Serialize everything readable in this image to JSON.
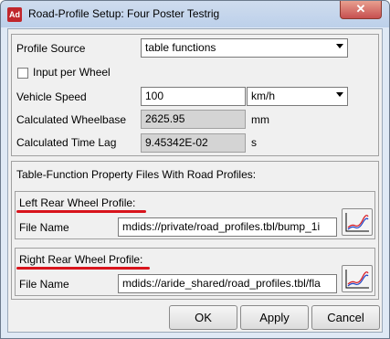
{
  "window": {
    "title": "Road-Profile Setup: Four Poster Testrig",
    "app_icon_label": "Ad",
    "close_label": "✕"
  },
  "form": {
    "profile_source_label": "Profile Source",
    "profile_source_value": "table functions",
    "input_per_wheel_label": "Input per Wheel",
    "input_per_wheel_checked": false,
    "vehicle_speed_label": "Vehicle Speed",
    "vehicle_speed_value": "100",
    "vehicle_speed_unit": "km/h",
    "wheelbase_label": "Calculated Wheelbase",
    "wheelbase_value": "2625.95",
    "wheelbase_unit": "mm",
    "time_lag_label": "Calculated Time Lag",
    "time_lag_value": "9.45342E-02",
    "time_lag_unit": "s"
  },
  "profiles": {
    "section_title": "Table-Function Property Files With Road Profiles:",
    "left": {
      "title": "Left Rear Wheel Profile:",
      "file_label": "File Name",
      "file_value": "mdids://private/road_profiles.tbl/bump_1i"
    },
    "right": {
      "title": "Right Rear Wheel Profile:",
      "file_label": "File Name",
      "file_value": "mdids://aride_shared/road_profiles.tbl/fla"
    }
  },
  "buttons": {
    "ok": "OK",
    "apply": "Apply",
    "cancel": "Cancel"
  },
  "colors": {
    "annotation_underline": "#d8141c",
    "titlebar": "#bcd0ea",
    "close_button": "#c75050"
  }
}
